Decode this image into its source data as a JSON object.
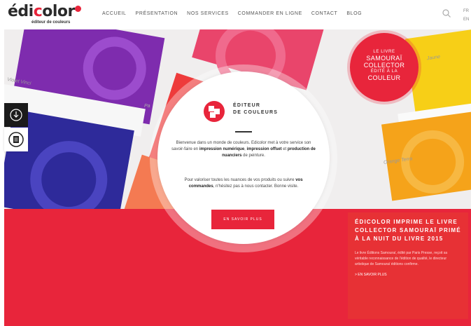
{
  "header": {
    "logo_text_1": "édi",
    "logo_text_2": "c",
    "logo_text_3": "olor",
    "logo_tagline": "éditeur de couleurs",
    "nav": [
      {
        "label": "ACCUEIL"
      },
      {
        "label": "PRÉSENTATION"
      },
      {
        "label": "NOS SERVICES"
      },
      {
        "label": "COMMANDER EN LIGNE"
      },
      {
        "label": "CONTACT"
      },
      {
        "label": "BLOG"
      }
    ],
    "lang_1": "FR",
    "lang_2": "EN",
    "search_icon": "search-icon"
  },
  "hero": {
    "swatch_labels": {
      "violet": "Violet Vinci",
      "jaune": "Jaune",
      "orange": "Orange Terra",
      "pa": "Pa"
    },
    "promo": {
      "line1": "LE LIVRE",
      "line2": "SAMOURAÏ",
      "line3": "COLLECTOR",
      "line4": "ÉDITÉ À LA",
      "big": "COULEUR"
    }
  },
  "center": {
    "heading_line1": "ÉDITEUR",
    "heading_line2": "DE COULEURS",
    "p1_a": "Bienvenue dans un monde de couleurs. Edicolor met à votre service son savoir-faire en ",
    "p1_b1": "impression numérique",
    "p1_c": ", ",
    "p1_b2": "impression offset",
    "p1_d": " et ",
    "p1_b3": "production de nuanciers",
    "p1_e": " de peinture.",
    "p2_a": "Pour valoriser toutes les nuances de vos produits ou suivre ",
    "p2_b": "vos commandes",
    "p2_c": ", n'hésitez pas à nous contacter. Bonne visite.",
    "cta_label": "EN SAVOIR PLUS"
  },
  "award": {
    "title": "ÉDICOLOR IMPRIME LE LIVRE COLLECTOR SAMOURAÏ PRIMÉ À LA NUIT DU LIVRE 2015",
    "desc": "Le livre Éditions Samouraï, édité par Paris Presse, reçoit sa véritable reconnaissance de l'édition de qualité, le directeur artistique de Samouraï éditions confirme.",
    "link": "> EN SAVOIR PLUS"
  },
  "side": {
    "btn1_icon": "download-icon",
    "btn2_icon": "document-icon"
  },
  "colors": {
    "brand_red": "#e8253b",
    "purple": "#7e2cae",
    "blue": "#2e2a9a",
    "yellow": "#f7cf17",
    "orange": "#f5a31a"
  }
}
